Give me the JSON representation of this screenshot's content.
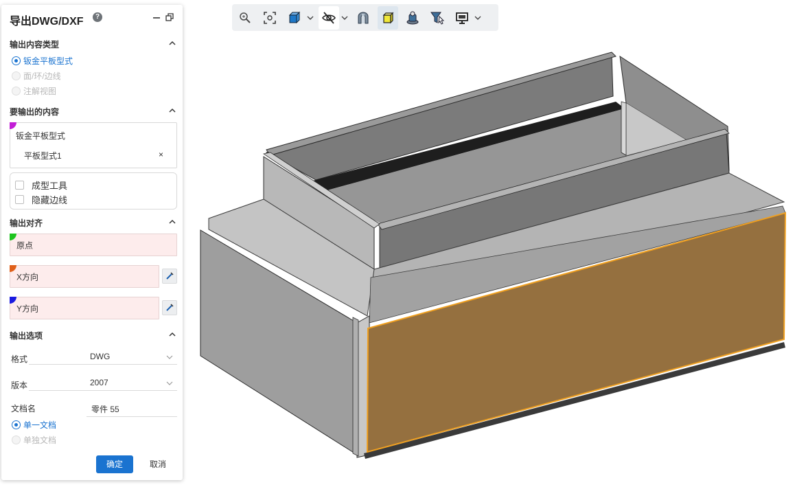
{
  "panel": {
    "title": "导出DWG/DXF",
    "help_icon": "question-circle-icon",
    "sections": {
      "output_type": {
        "title": "输出内容类型",
        "options": [
          "钣金平板型式",
          "面/环/边线",
          "注解视图"
        ],
        "selected": "钣金平板型式"
      },
      "content": {
        "title": "要输出的内容",
        "box_title": "钣金平板型式",
        "item": "平板型式1",
        "remove_symbol": "×",
        "checkboxes": [
          "成型工具",
          "隐藏边线"
        ]
      },
      "align": {
        "title": "输出对齐",
        "origin": "原点",
        "x_dir": "X方向",
        "y_dir": "Y方向"
      },
      "options": {
        "title": "输出选项",
        "format_label": "格式",
        "format_value": "DWG",
        "version_label": "版本",
        "version_value": "2007",
        "docname_label": "文档名",
        "docname_value": "零件 55",
        "doc_modes": [
          "单一文档",
          "单独文档"
        ],
        "doc_mode_selected": "单一文档"
      }
    },
    "buttons": {
      "ok": "确定",
      "cancel": "取消"
    }
  },
  "toolbar": {
    "tools": [
      "zoom-icon",
      "fit-view-icon",
      "view-cube-icon",
      "visibility-icon",
      "section-view-icon",
      "shaded-icon",
      "appearance-icon",
      "filter-icon",
      "display-icon"
    ]
  },
  "colors": {
    "accent": "#1a73d0",
    "selected_face": "#95703f",
    "selected_edge": "#f0a020",
    "flag_content": "#c21ed6",
    "flag_origin": "#1ec41e",
    "flag_x": "#e0601a",
    "flag_y": "#1a1ae0",
    "field_bg": "#fdecec"
  }
}
